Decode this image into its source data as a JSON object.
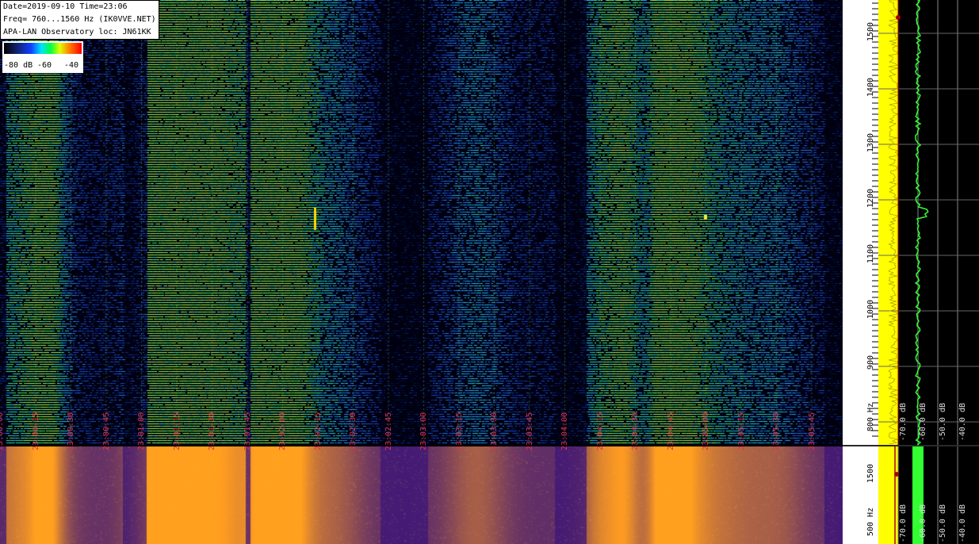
{
  "info": {
    "line1": "Date=2019-09-10 Time=23:06",
    "line2": "Freq= 760...1560 Hz (IK0VVE.NET)",
    "line3": "APA-LAN Observatory loc: JN61KK"
  },
  "legend": {
    "a": "-80 dB",
    "b": "-60",
    "c": "-40"
  },
  "time_labels": [
    "23:00:00",
    "23:00:15",
    "23:00:30",
    "23:00:45",
    "23:01:00",
    "23:01:15",
    "23:01:30",
    "23:01:45",
    "23:02:00",
    "23:02:15",
    "23:02:30",
    "23:02:45",
    "23:03:00",
    "23:03:15",
    "23:03:30",
    "23:03:45",
    "23:04:00",
    "23:04:15",
    "23:04:30",
    "23:04:45",
    "23:05:00",
    "23:05:15",
    "23:05:30",
    "23:05:45"
  ],
  "freq_labels": [
    "1500",
    "1400",
    "1300",
    "1200",
    "1100",
    "1000",
    "900",
    "800 Hz"
  ],
  "freq_labels_bottom": [
    "1500",
    "500 Hz"
  ],
  "db_labels": [
    "-70.0 dB",
    "-60.0 dB",
    "-50.0 dB",
    "-40.0 dB"
  ],
  "db_labels_bottom": [
    "-70.0 dB",
    "-60.0 dB",
    "-50.0 dB",
    "-40.0 dB"
  ],
  "colors": {
    "bg": "#000000",
    "spectrum_line": "#33ff33",
    "level": "#ffff00",
    "time_text": "#e0304a"
  }
}
